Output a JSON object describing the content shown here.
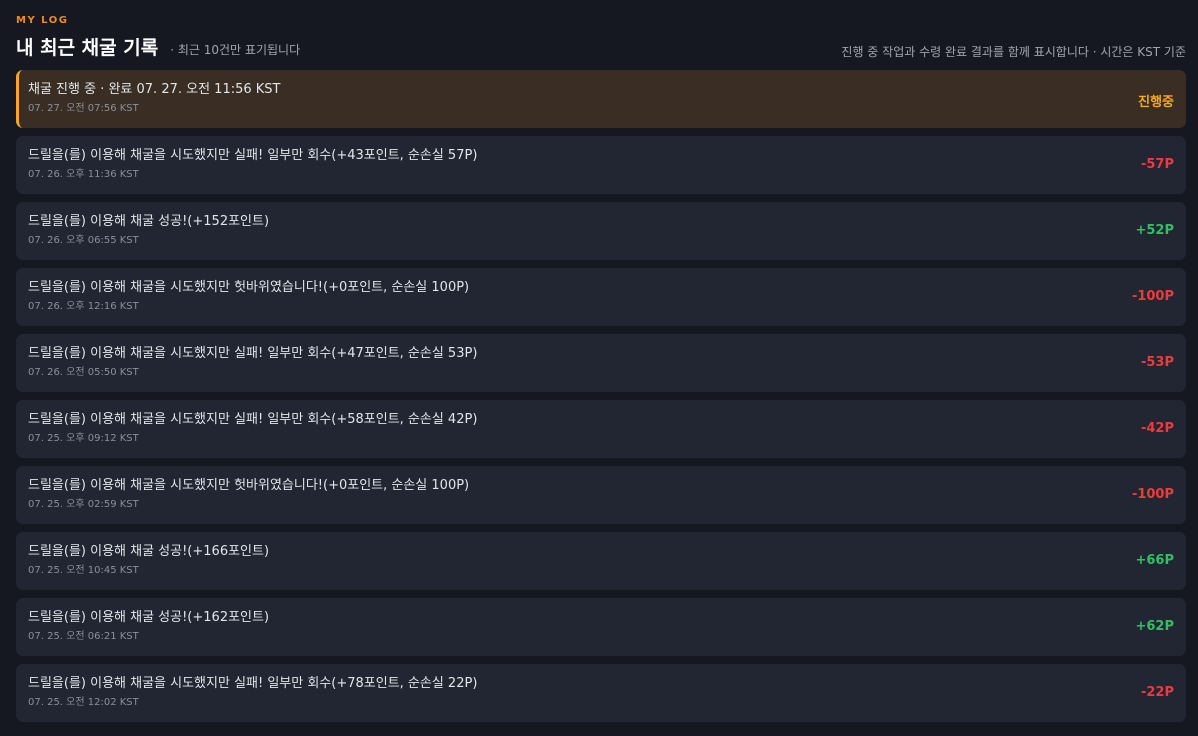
{
  "header": {
    "eyebrow": "MY LOG",
    "title": "내 최근 채굴 기록",
    "subtitle": "· 최근 10건만 표기됩니다",
    "note": "진행 중 작업과 수령 완료 결과를 함께 표시합니다 · 시간은 KST 기준"
  },
  "colors": {
    "accent": "#f5a623",
    "negative": "#ef3b3b",
    "positive": "#2ec066"
  },
  "logs": [
    {
      "title": "채굴 진행 중 · 완료 07. 27. 오전 11:56 KST",
      "time": "07. 27. 오전 07:56 KST",
      "value": "진행중",
      "status": "pending"
    },
    {
      "title": "드릴을(를) 이용해 채굴을 시도했지만 실패! 일부만 회수(+43포인트, 순손실 57P)",
      "time": "07. 26. 오후 11:36 KST",
      "value": "-57P",
      "status": "negative"
    },
    {
      "title": "드릴을(를) 이용해 채굴 성공!(+152포인트)",
      "time": "07. 26. 오후 06:55 KST",
      "value": "+52P",
      "status": "positive"
    },
    {
      "title": "드릴을(를) 이용해 채굴을 시도했지만 헛바위였습니다!(+0포인트, 순손실 100P)",
      "time": "07. 26. 오후 12:16 KST",
      "value": "-100P",
      "status": "negative"
    },
    {
      "title": "드릴을(를) 이용해 채굴을 시도했지만 실패! 일부만 회수(+47포인트, 순손실 53P)",
      "time": "07. 26. 오전 05:50 KST",
      "value": "-53P",
      "status": "negative"
    },
    {
      "title": "드릴을(를) 이용해 채굴을 시도했지만 실패! 일부만 회수(+58포인트, 순손실 42P)",
      "time": "07. 25. 오후 09:12 KST",
      "value": "-42P",
      "status": "negative"
    },
    {
      "title": "드릴을(를) 이용해 채굴을 시도했지만 헛바위였습니다!(+0포인트, 순손실 100P)",
      "time": "07. 25. 오후 02:59 KST",
      "value": "-100P",
      "status": "negative"
    },
    {
      "title": "드릴을(를) 이용해 채굴 성공!(+166포인트)",
      "time": "07. 25. 오전 10:45 KST",
      "value": "+66P",
      "status": "positive"
    },
    {
      "title": "드릴을(를) 이용해 채굴 성공!(+162포인트)",
      "time": "07. 25. 오전 06:21 KST",
      "value": "+62P",
      "status": "positive"
    },
    {
      "title": "드릴을(를) 이용해 채굴을 시도했지만 실패! 일부만 회수(+78포인트, 순손실 22P)",
      "time": "07. 25. 오전 12:02 KST",
      "value": "-22P",
      "status": "negative"
    }
  ]
}
